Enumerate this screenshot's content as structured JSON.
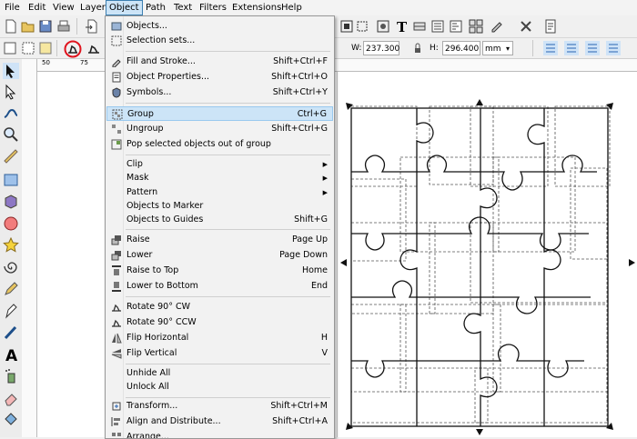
{
  "menubar": {
    "items": [
      "File",
      "Edit",
      "View",
      "Layer",
      "Object",
      "Path",
      "Text",
      "Filters",
      "Extensions",
      "Help"
    ]
  },
  "toolbar": {
    "w_label": "W:",
    "w_value": "237.300",
    "h_label": "H:",
    "h_value": "296.400",
    "unit": "mm"
  },
  "ruler": {
    "marks": [
      "50",
      "75"
    ]
  },
  "object_menu": {
    "items": [
      {
        "label": "Objects...",
        "shortcut": "",
        "icon": "objects-icon"
      },
      {
        "label": "Selection sets...",
        "shortcut": "",
        "icon": "selection-sets-icon"
      },
      {
        "label": "Fill and Stroke...",
        "shortcut": "Shift+Ctrl+F",
        "icon": "fill-stroke-icon"
      },
      {
        "label": "Object Properties...",
        "shortcut": "Shift+Ctrl+O",
        "icon": "object-properties-icon"
      },
      {
        "label": "Symbols...",
        "shortcut": "Shift+Ctrl+Y",
        "icon": "symbols-icon"
      },
      {
        "label": "Group",
        "shortcut": "Ctrl+G",
        "icon": "group-icon"
      },
      {
        "label": "Ungroup",
        "shortcut": "Shift+Ctrl+G",
        "icon": "ungroup-icon"
      },
      {
        "label": "Pop selected objects out of group",
        "shortcut": "",
        "icon": "pop-out-icon"
      },
      {
        "label": "Clip",
        "shortcut": "",
        "icon": ""
      },
      {
        "label": "Mask",
        "shortcut": "",
        "icon": ""
      },
      {
        "label": "Pattern",
        "shortcut": "",
        "icon": ""
      },
      {
        "label": "Objects to Marker",
        "shortcut": "",
        "icon": ""
      },
      {
        "label": "Objects to Guides",
        "shortcut": "Shift+G",
        "icon": ""
      },
      {
        "label": "Raise",
        "shortcut": "Page Up",
        "icon": "raise-icon"
      },
      {
        "label": "Lower",
        "shortcut": "Page Down",
        "icon": "lower-icon"
      },
      {
        "label": "Raise to Top",
        "shortcut": "Home",
        "icon": "raise-top-icon"
      },
      {
        "label": "Lower to Bottom",
        "shortcut": "End",
        "icon": "lower-bottom-icon"
      },
      {
        "label": "Rotate 90° CW",
        "shortcut": "",
        "icon": "rotate-cw-icon"
      },
      {
        "label": "Rotate 90° CCW",
        "shortcut": "",
        "icon": "rotate-ccw-icon"
      },
      {
        "label": "Flip Horizontal",
        "shortcut": "H",
        "icon": "flip-horizontal-icon"
      },
      {
        "label": "Flip Vertical",
        "shortcut": "V",
        "icon": "flip-vertical-icon"
      },
      {
        "label": "Unhide All",
        "shortcut": "",
        "icon": ""
      },
      {
        "label": "Unlock All",
        "shortcut": "",
        "icon": ""
      },
      {
        "label": "Transform...",
        "shortcut": "Shift+Ctrl+M",
        "icon": "transform-icon"
      },
      {
        "label": "Align and Distribute...",
        "shortcut": "Shift+Ctrl+A",
        "icon": "align-distribute-icon"
      },
      {
        "label": "Arrange...",
        "shortcut": "",
        "icon": "arrange-icon"
      }
    ]
  },
  "colors": {
    "menu_highlight": "#cce4f7",
    "annotation_circle": "#e0141e"
  }
}
